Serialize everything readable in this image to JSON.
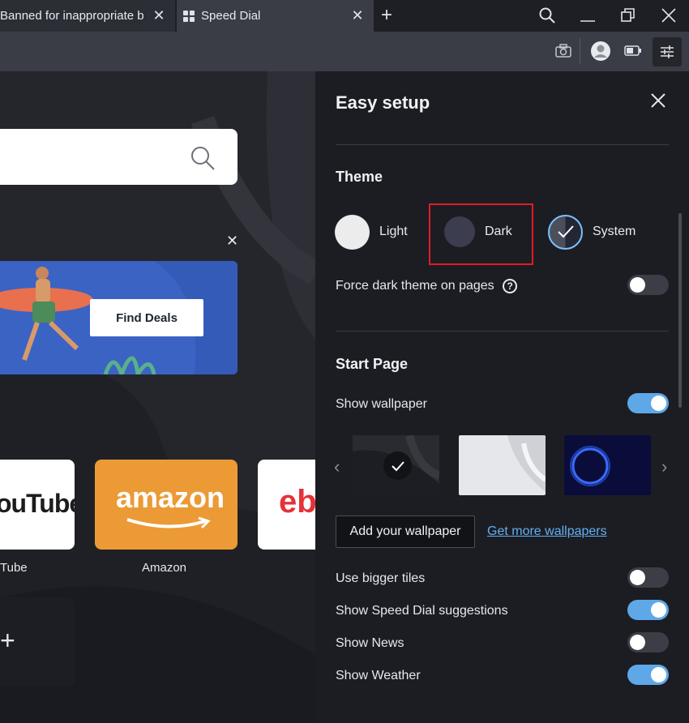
{
  "tabs": [
    {
      "title": "Banned for inappropriate b"
    },
    {
      "title": "Speed Dial"
    }
  ],
  "speed_dial": {
    "promo_button": "Find Deals",
    "tiles": [
      {
        "logo": "ouTube",
        "label": "Tube"
      },
      {
        "logo": "amazon",
        "label": "Amazon"
      },
      {
        "logo": "eb",
        "label": ""
      }
    ],
    "add_tile": "+"
  },
  "easy_setup": {
    "title": "Easy setup",
    "theme": {
      "title": "Theme",
      "options": [
        "Light",
        "Dark",
        "System"
      ],
      "selected": "System",
      "force_dark_label": "Force dark theme on pages",
      "force_dark_on": false
    },
    "start_page": {
      "title": "Start Page",
      "show_wallpaper_label": "Show wallpaper",
      "show_wallpaper_on": true,
      "add_wallpaper": "Add your wallpaper",
      "get_more": "Get more wallpapers",
      "settings": [
        {
          "label": "Use bigger tiles",
          "on": false
        },
        {
          "label": "Show Speed Dial suggestions",
          "on": true
        },
        {
          "label": "Show News",
          "on": false
        },
        {
          "label": "Show Weather",
          "on": true
        }
      ]
    }
  },
  "colors": {
    "accent": "#5ea8e8",
    "link": "#63aff0",
    "highlight": "#e01b24",
    "panel_bg": "#1c1d23"
  }
}
